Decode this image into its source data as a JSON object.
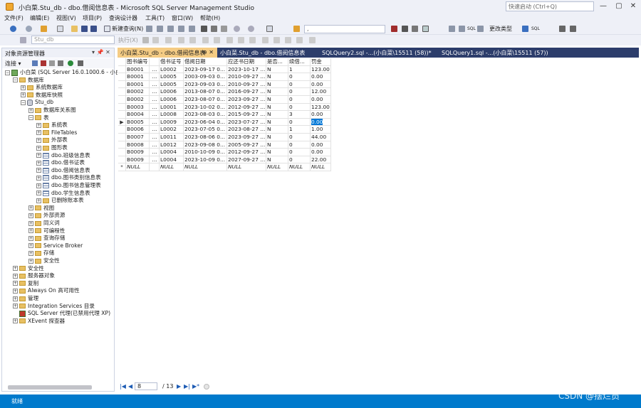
{
  "window": {
    "title": "小白菜.Stu_db - dbo.借阅信息表 - Microsoft SQL Server Management Studio",
    "quick_launch_placeholder": "快速启动 (Ctrl+Q)",
    "minimize": "—",
    "restore": "▢",
    "close": "✕"
  },
  "menu": [
    "文件(F)",
    "编辑(E)",
    "视图(V)",
    "项目(P)",
    "查询设计器",
    "工具(T)",
    "窗口(W)",
    "帮助(H)"
  ],
  "toolbar": {
    "new_query": "新建查询(N)",
    "database_combo": "Stu_db",
    "execute": "执行(X)",
    "change_type": "更改类型",
    "sql_label": "SQL"
  },
  "object_explorer": {
    "title": "对象资源管理器",
    "pin": "▾ 📌 ✕",
    "connect": "连接 ▾",
    "tree": [
      {
        "label": "小白菜 (SQL Server 16.0.1000.6 - 小白",
        "level": 0,
        "icon": "server-icon",
        "exp": "−"
      },
      {
        "label": "数据库",
        "level": 1,
        "icon": "folder-icon",
        "exp": "−"
      },
      {
        "label": "系统数据库",
        "level": 2,
        "icon": "folder-icon",
        "exp": "+"
      },
      {
        "label": "数据库快照",
        "level": 2,
        "icon": "folder-icon",
        "exp": "+"
      },
      {
        "label": "Stu_db",
        "level": 2,
        "icon": "database-icon",
        "exp": "−"
      },
      {
        "label": "数据库关系图",
        "level": 3,
        "icon": "folder-icon",
        "exp": "+"
      },
      {
        "label": "表",
        "level": 3,
        "icon": "folder-icon",
        "exp": "−"
      },
      {
        "label": "系统表",
        "level": 4,
        "icon": "folder-icon",
        "exp": "+"
      },
      {
        "label": "FileTables",
        "level": 4,
        "icon": "folder-icon",
        "exp": "+"
      },
      {
        "label": "外部表",
        "level": 4,
        "icon": "folder-icon",
        "exp": "+"
      },
      {
        "label": "图形表",
        "level": 4,
        "icon": "folder-icon",
        "exp": "+"
      },
      {
        "label": "dbo.班级信息表",
        "level": 4,
        "icon": "table-icon",
        "exp": "+"
      },
      {
        "label": "dbo.借书证表",
        "level": 4,
        "icon": "table-icon",
        "exp": "+"
      },
      {
        "label": "dbo.借阅信息表",
        "level": 4,
        "icon": "table-icon",
        "exp": "+"
      },
      {
        "label": "dbo.图书类别信息表",
        "level": 4,
        "icon": "table-icon",
        "exp": "+"
      },
      {
        "label": "dbo.图书信息管理表",
        "level": 4,
        "icon": "table-icon",
        "exp": "+"
      },
      {
        "label": "dbo.学生信息表",
        "level": 4,
        "icon": "table-icon",
        "exp": "+"
      },
      {
        "label": "已删除账本表",
        "level": 4,
        "icon": "folder-icon",
        "exp": "+"
      },
      {
        "label": "视图",
        "level": 3,
        "icon": "folder-icon",
        "exp": "+"
      },
      {
        "label": "外部资源",
        "level": 3,
        "icon": "folder-icon",
        "exp": "+"
      },
      {
        "label": "同义词",
        "level": 3,
        "icon": "folder-icon",
        "exp": "+"
      },
      {
        "label": "可编程性",
        "level": 3,
        "icon": "folder-icon",
        "exp": "+"
      },
      {
        "label": "查询存储",
        "level": 3,
        "icon": "folder-icon",
        "exp": "+"
      },
      {
        "label": "Service Broker",
        "level": 3,
        "icon": "folder-icon",
        "exp": "+"
      },
      {
        "label": "存储",
        "level": 3,
        "icon": "folder-icon",
        "exp": "+"
      },
      {
        "label": "安全性",
        "level": 3,
        "icon": "folder-icon",
        "exp": "+"
      },
      {
        "label": "安全性",
        "level": 1,
        "icon": "folder-icon",
        "exp": "+"
      },
      {
        "label": "服务器对象",
        "level": 1,
        "icon": "folder-icon",
        "exp": "+"
      },
      {
        "label": "复制",
        "level": 1,
        "icon": "folder-icon",
        "exp": "+"
      },
      {
        "label": "Always On 高可用性",
        "level": 1,
        "icon": "folder-icon",
        "exp": "+"
      },
      {
        "label": "管理",
        "level": 1,
        "icon": "folder-icon",
        "exp": "+"
      },
      {
        "label": "Integration Services 目录",
        "level": 1,
        "icon": "folder-icon",
        "exp": "+"
      },
      {
        "label": "SQL Server 代理(已禁用代理 XP)",
        "level": 1,
        "icon": "agent-icon",
        "exp": ""
      },
      {
        "label": "XEvent 探查器",
        "level": 1,
        "icon": "folder-icon",
        "exp": "+"
      }
    ]
  },
  "tabs": [
    {
      "label": "小白菜.Stu_db - dbo.借阅信息表",
      "active": true,
      "pin": "⊕ ✕"
    },
    {
      "label": "小白菜.Stu_db - dbo.借阅信息表",
      "active": false
    },
    {
      "label": "SQLQuery2.sql -...(小白菜\\15511 (58))*",
      "active": false
    },
    {
      "label": "SQLQuery1.sql -...(小白菜\\15511 (57))",
      "active": false
    }
  ],
  "grid": {
    "columns": [
      "图书编号",
      "借书证号",
      "借阅日期",
      "应还书日期",
      "是否...",
      "续借...",
      "罚金"
    ],
    "rows": [
      [
        "B0001",
        "L0002",
        "2023-09-17 0...",
        "2023-10-17 ...",
        "N",
        "1",
        "123.00"
      ],
      [
        "B0001",
        "L0005",
        "2003-09-03 0...",
        "2010-09-27 ...",
        "N",
        "0",
        "0.00"
      ],
      [
        "B0001",
        "L0005",
        "2023-09-03 0...",
        "2010-09-27 ...",
        "N",
        "0",
        "0.00"
      ],
      [
        "B0002",
        "L0006",
        "2013-08-07 0...",
        "2016-09-27 ...",
        "N",
        "0",
        "12.00"
      ],
      [
        "B0002",
        "L0006",
        "2023-08-07 0...",
        "2023-09-27 ...",
        "N",
        "0",
        "0.00"
      ],
      [
        "B0003",
        "L0001",
        "2023-10-02 0...",
        "2012-09-27 ...",
        "N",
        "0",
        "123.00"
      ],
      [
        "B0004",
        "L0008",
        "2023-08-03 0...",
        "2015-09-27 ...",
        "N",
        "3",
        "0.00"
      ],
      [
        "B0005",
        "L0009",
        "2023-06-04 0...",
        "2023-07-27 ...",
        "N",
        "0",
        "0.00"
      ],
      [
        "B0006",
        "L0002",
        "2023-07-05 0...",
        "2023-08-27 ...",
        "N",
        "1",
        "1.00"
      ],
      [
        "B0007",
        "L0011",
        "2023-08-06 0...",
        "2023-09-27 ...",
        "N",
        "0",
        "44.00"
      ],
      [
        "B0008",
        "L0012",
        "2023-09-08 0...",
        "2005-09-27 ...",
        "N",
        "0",
        "0.00"
      ],
      [
        "B0009",
        "L0004",
        "2010-10-09 0...",
        "2012-09-27 ...",
        "N",
        "0",
        "0.00"
      ],
      [
        "B0009",
        "L0004",
        "2023-10-09 0...",
        "2027-09-27 ...",
        "N",
        "0",
        "22.00"
      ],
      [
        "NULL",
        "NULL",
        "NULL",
        "NULL",
        "NULL",
        "NULL",
        "NULL"
      ]
    ],
    "current_row_marker": "▶",
    "new_row_marker": "*",
    "ellipsis": "..."
  },
  "navigator": {
    "first": "|◀",
    "prev": "◀",
    "current": "8",
    "total": "/ 13",
    "next": "▶",
    "last": "▶|",
    "new": "▶*"
  },
  "status": {
    "text": "就绪"
  },
  "watermark": "CSDN @摆烂员",
  "colors": {
    "accent": "#007acc",
    "tab_active": "#f5cc84",
    "tab_strip": "#2c3d6b",
    "selection": "#0078d7"
  }
}
